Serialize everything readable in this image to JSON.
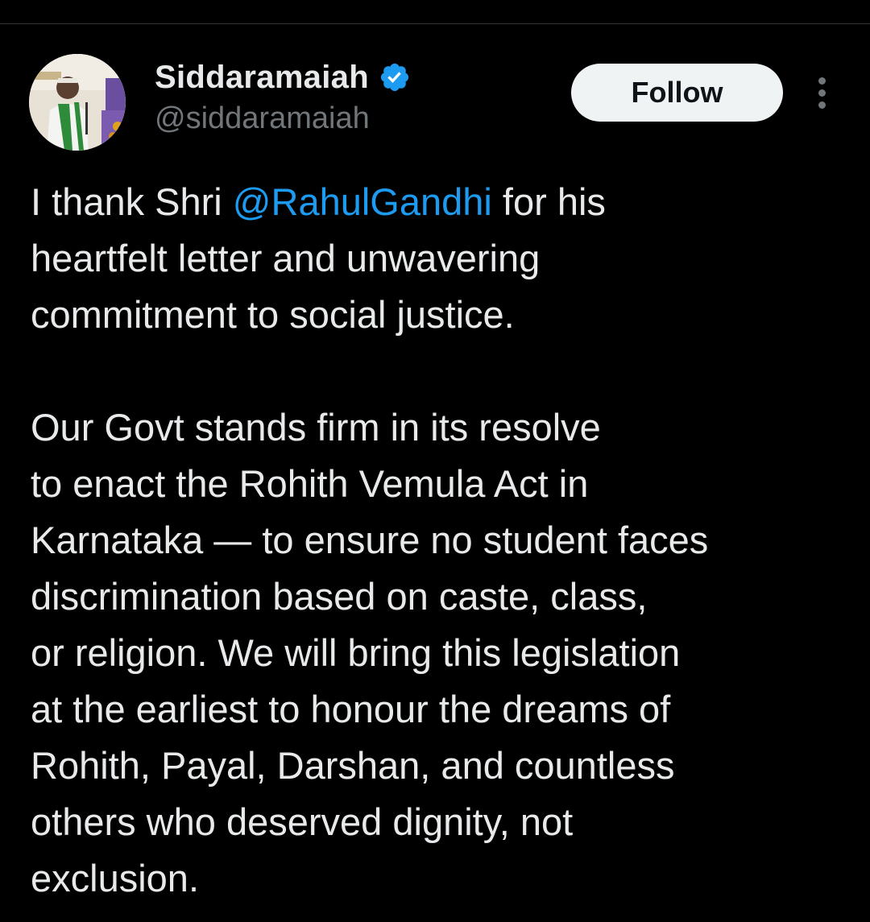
{
  "author": {
    "display_name": "Siddaramaiah",
    "handle": "@siddaramaiah",
    "verified": true,
    "verified_color": "#1d9bf0"
  },
  "actions": {
    "follow_label": "Follow"
  },
  "tweet": {
    "p1": {
      "l1_pre": "I thank Shri ",
      "mention": "@RahulGandhi",
      "l1_post": " for his",
      "l2": "heartfelt letter and unwavering",
      "l3": "commitment to social justice."
    },
    "p2": {
      "l1": "Our Govt stands firm in its resolve",
      "l2": "to enact the Rohith Vemula Act in",
      "l3": "Karnataka — to ensure no student faces",
      "l4": "discrimination based on caste, class,",
      "l5": "or religion. We will bring this legislation",
      "l6": "at the earliest to honour the dreams of",
      "l7": "Rohith, Payal, Darshan, and countless",
      "l8": "others who deserved dignity, not",
      "l9": "exclusion."
    }
  },
  "colors": {
    "background": "#000000",
    "text": "#e7e9ea",
    "secondary_text": "#71767b",
    "link": "#1d9bf0",
    "follow_bg": "#eff3f4"
  },
  "icons": {
    "verified": "verified-badge-icon",
    "more": "more-options-icon"
  }
}
